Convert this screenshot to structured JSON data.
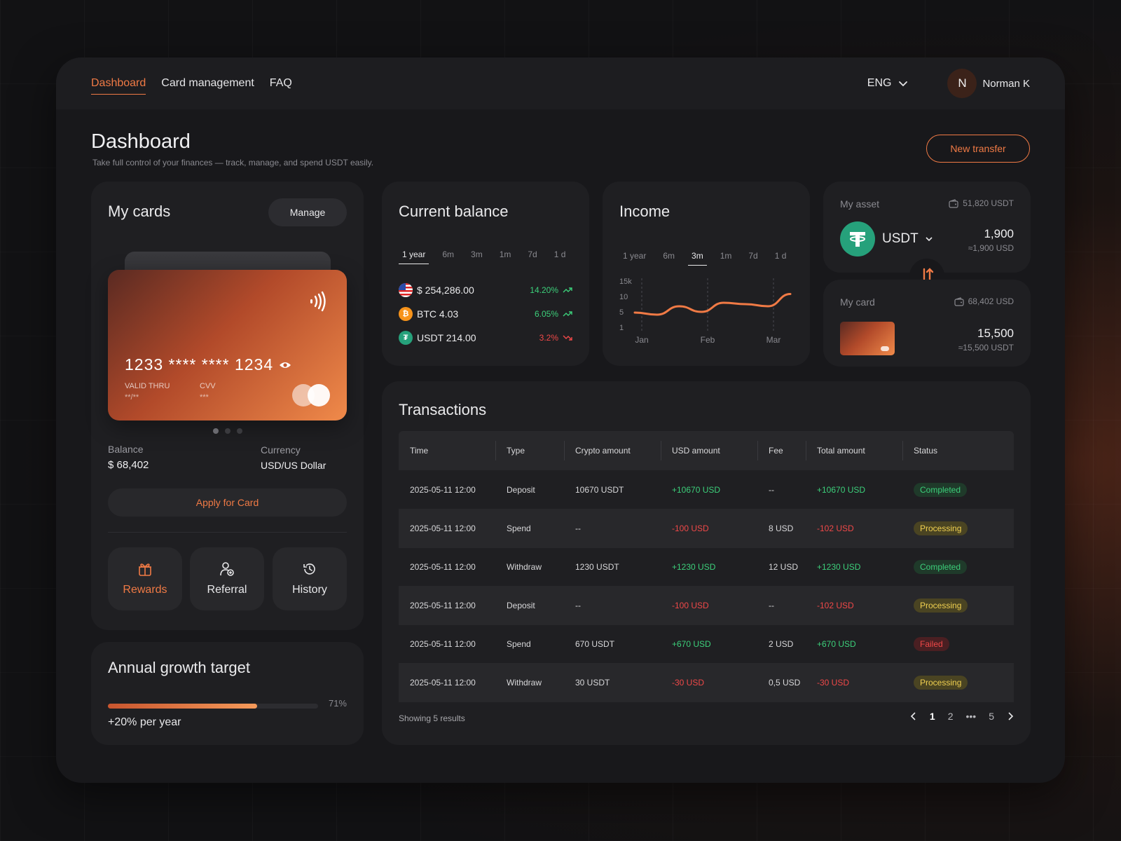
{
  "nav": {
    "items": [
      {
        "label": "Dashboard",
        "active": true
      },
      {
        "label": "Card management",
        "active": false
      },
      {
        "label": "FAQ",
        "active": false
      }
    ],
    "language": "ENG",
    "user": {
      "initial": "N",
      "name": "Norman K"
    }
  },
  "header": {
    "title": "Dashboard",
    "subtitle": "Take full control of your finances — track, manage, and spend USDT easily.",
    "new_transfer_label": "New transfer"
  },
  "my_cards": {
    "title": "My cards",
    "manage_label": "Manage",
    "card_number": "1233 **** **** 1234",
    "valid_thru_label": "VALID THRU",
    "valid_thru_value": "**/**",
    "cvv_label": "CVV",
    "cvv_value": "***",
    "balance_label": "Balance",
    "balance_value": "$ 68,402",
    "currency_label": "Currency",
    "currency_value": "USD/US Dollar",
    "apply_label": "Apply for Card",
    "quick_actions": [
      {
        "label": "Rewards",
        "icon": "gift-icon",
        "active": true
      },
      {
        "label": "Referral",
        "icon": "add-user-icon",
        "active": false
      },
      {
        "label": "History",
        "icon": "history-icon",
        "active": false
      }
    ]
  },
  "growth": {
    "title": "Annual growth target",
    "percent_label": "71%",
    "progress": 0.71,
    "subtitle": "+20% per year"
  },
  "balance": {
    "title": "Current balance",
    "tabs": [
      "1 year",
      "6m",
      "3m",
      "1m",
      "7d",
      "1 d"
    ],
    "active_tab": "1 year",
    "rows": [
      {
        "label": "$ 254,286.00",
        "change": "14.20%",
        "trend": "up"
      },
      {
        "label": "BTC 4.03",
        "change": "6.05%",
        "trend": "up"
      },
      {
        "label": "USDT 214.00",
        "change": "3.2%",
        "trend": "down"
      }
    ]
  },
  "income": {
    "title": "Income",
    "tabs": [
      "1 year",
      "6m",
      "3m",
      "1m",
      "7d",
      "1 d"
    ],
    "active_tab": "3m"
  },
  "chart_data": {
    "type": "line",
    "title": "Income",
    "x_tick_labels": [
      "Jan",
      "Feb",
      "Mar"
    ],
    "y_tick_labels": [
      "15k",
      "10",
      "5",
      "1"
    ],
    "series": [
      {
        "values": [
          5.2,
          4.6,
          7.0,
          5.4,
          8.0,
          7.6,
          7.0,
          10.5
        ]
      }
    ],
    "color": "#f07a45",
    "ylim": [
      1,
      15
    ]
  },
  "asset": {
    "title": "My asset",
    "total": "51,820 USDT",
    "currency": "USDT",
    "amount": "1,900",
    "amount_usd": "≈1,900 USD"
  },
  "my_card_widget": {
    "title": "My card",
    "total": "68,402 USD",
    "amount": "15,500",
    "amount_usd": "≈15,500 USDT"
  },
  "transactions": {
    "title": "Transactions",
    "columns": [
      "Time",
      "Type",
      "Crypto amount",
      "USD amount",
      "Fee",
      "Total amount",
      "Status"
    ],
    "rows": [
      {
        "time": "2025-05-11 12:00",
        "type": "Deposit",
        "crypto": "10670 USDT",
        "usd": "+10670 USD",
        "fee": "--",
        "total": "+10670 USD",
        "status": "Completed",
        "dir": "up"
      },
      {
        "time": "2025-05-11 12:00",
        "type": "Spend",
        "crypto": "--",
        "usd": "-100 USD",
        "fee": "8 USD",
        "total": "-102 USD",
        "status": "Processing",
        "dir": "down"
      },
      {
        "time": "2025-05-11 12:00",
        "type": "Withdraw",
        "crypto": "1230 USDT",
        "usd": "+1230 USD",
        "fee": "12 USD",
        "total": "+1230 USD",
        "status": "Completed",
        "dir": "up"
      },
      {
        "time": "2025-05-11 12:00",
        "type": "Deposit",
        "crypto": "--",
        "usd": "-100 USD",
        "fee": "--",
        "total": "-102 USD",
        "status": "Processing",
        "dir": "down"
      },
      {
        "time": "2025-05-11 12:00",
        "type": "Spend",
        "crypto": "670 USDT",
        "usd": "+670 USD",
        "fee": "2 USD",
        "total": "+670 USD",
        "status": "Failed",
        "dir": "up"
      },
      {
        "time": "2025-05-11 12:00",
        "type": "Withdraw",
        "crypto": "30 USDT",
        "usd": "-30 USD",
        "fee": "0,5 USD",
        "total": "-30  USD",
        "status": "Processing",
        "dir": "down"
      }
    ],
    "summary": "Showing 5 results",
    "pages": [
      "1",
      "2",
      "•••",
      "5"
    ],
    "current_page": "1"
  },
  "colors": {
    "accent": "#f07a45",
    "positive": "#3ccf7a",
    "negative": "#ef4848",
    "warning": "#f0d050",
    "panel": "#1f1f22"
  }
}
